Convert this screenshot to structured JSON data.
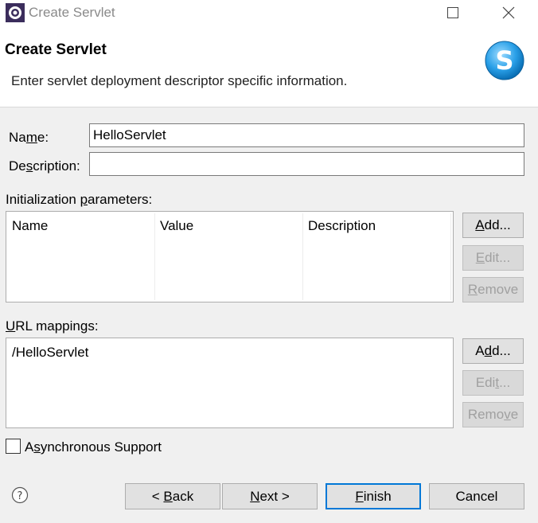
{
  "window": {
    "title": "Create Servlet"
  },
  "banner": {
    "title": "Create Servlet",
    "description": "Enter servlet deployment descriptor specific information."
  },
  "form": {
    "name_label_pre": "Na",
    "name_label_u": "m",
    "name_label_post": "e:",
    "name_value": "HelloServlet",
    "description_label_pre": "De",
    "description_label_u": "s",
    "description_label_post": "cription:",
    "description_value": ""
  },
  "init_params": {
    "label_pre": "Initialization ",
    "label_u": "p",
    "label_post": "arameters:",
    "columns": [
      "Name",
      "Value",
      "Description"
    ],
    "rows": [],
    "add_pre": "",
    "add_u": "A",
    "add_post": "dd...",
    "edit_pre": "",
    "edit_u": "E",
    "edit_post": "dit...",
    "remove_pre": "",
    "remove_u": "R",
    "remove_post": "emove"
  },
  "url_mappings": {
    "label_pre": "",
    "label_u": "U",
    "label_post": "RL mappings:",
    "rows": [
      "/HelloServlet"
    ],
    "add_pre": "A",
    "add_u": "d",
    "add_post": "d...",
    "edit_pre": "Edi",
    "edit_u": "t",
    "edit_post": "...",
    "remove_pre": "Remo",
    "remove_u": "v",
    "remove_post": "e"
  },
  "async": {
    "label_pre": "A",
    "label_u": "s",
    "label_post": "ynchronous Support",
    "checked": false
  },
  "buttons": {
    "back_pre": "< ",
    "back_u": "B",
    "back_post": "ack",
    "next_pre": "",
    "next_u": "N",
    "next_post": "ext >",
    "finish_pre": "",
    "finish_u": "F",
    "finish_post": "inish",
    "cancel": "Cancel"
  },
  "icons": {
    "app": "eclipse-gear-icon",
    "banner": "servlet-s-icon",
    "help": "help-icon",
    "minimize": "maximize-icon",
    "close": "close-icon"
  }
}
